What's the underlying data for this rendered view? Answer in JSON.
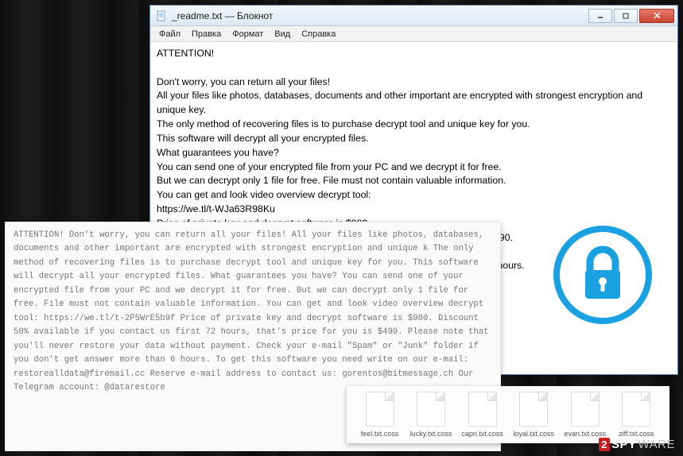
{
  "notepad": {
    "title": "_readme.txt — Блокнот",
    "menu": [
      "Файл",
      "Правка",
      "Формат",
      "Вид",
      "Справка"
    ],
    "body": "ATTENTION!\n\nDon't worry, you can return all your files!\nAll your files like photos, databases, documents and other important are encrypted with strongest encryption and unique key.\nThe only method of recovering files is to purchase decrypt tool and unique key for you.\nThis software will decrypt all your encrypted files.\nWhat guarantees you have?\nYou can send one of your encrypted file from your PC and we decrypt it for free.\nBut we can decrypt only 1 file for free. File must not contain valuable information.\nYou can get and look video overview decrypt tool:\nhttps://we.tl/t-WJa63R98Ku\nPrice of private key and decrypt software is $980.\nDiscount 50% available if you contact us first 72 hours, that's price for you is $490.\nPlease note that you'll never restore your data without payment.\nCheck your e-mail \"Spam\" or \"Junk\" folder if you don't get answer more than 6 hours."
  },
  "plaintext": {
    "body": "ATTENTION!\n\nDon't worry, you can return all your files!\nAll your files like photos, databases, documents and other important are encrypted with strongest encryption and unique k\nThe only method of recovering files is to purchase decrypt tool and unique key for you.\nThis software will decrypt all your encrypted files.\nWhat guarantees you have?\nYou can send one of your encrypted file from your PC and we decrypt it for free.\nBut we can decrypt only 1 file for free. File must not contain valuable information.\nYou can get and look video overview decrypt tool:\nhttps://we.tl/t-2P5WrE5b9f\nPrice of private key and decrypt software is $980.\nDiscount 50% available if you contact us first 72 hours, that's price for you is $490.\nPlease note that you'll never restore your data without payment.\nCheck your e-mail \"Spam\" or \"Junk\" folder if you don't get answer more than 6 hours.\n\nTo get this software you need write on our e-mail:\nrestorealldata@firemail.cc\n\nReserve e-mail address to contact us:\ngorentos@bitmessage.ch\n\nOur Telegram account:\n@datarestore"
  },
  "files": [
    "feel.txt.coss",
    "lucky.txt.coss",
    "capri.txt.coss",
    "loyal.txt.coss",
    "evan.txt.coss",
    "ziff.txt.coss"
  ],
  "watermark": {
    "two": "2",
    "spy": "SPY",
    "ware": "WARE"
  },
  "colors": {
    "lock_accent": "#1aa1e2"
  }
}
